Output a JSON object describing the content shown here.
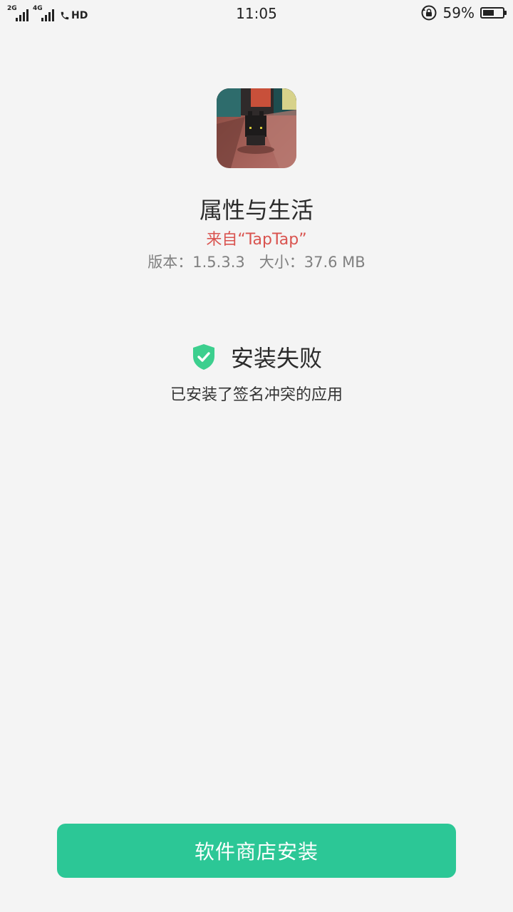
{
  "status_bar": {
    "sim1_label": "2G",
    "sim2_label": "4G",
    "hd_label": "HD",
    "time": "11:05",
    "battery_percent": "59%",
    "battery_level": 0.59
  },
  "app": {
    "name": "属性与生活",
    "source": "来自“TapTap”",
    "version_label": "版本：1.5.3.3",
    "size_label": "大小：37.6 MB"
  },
  "result": {
    "title": "安装失败",
    "reason": "已安装了签名冲突的应用",
    "shield_color": "#3ccf8e"
  },
  "actions": {
    "store_install_label": "软件商店安装",
    "button_color": "#2cc796"
  }
}
